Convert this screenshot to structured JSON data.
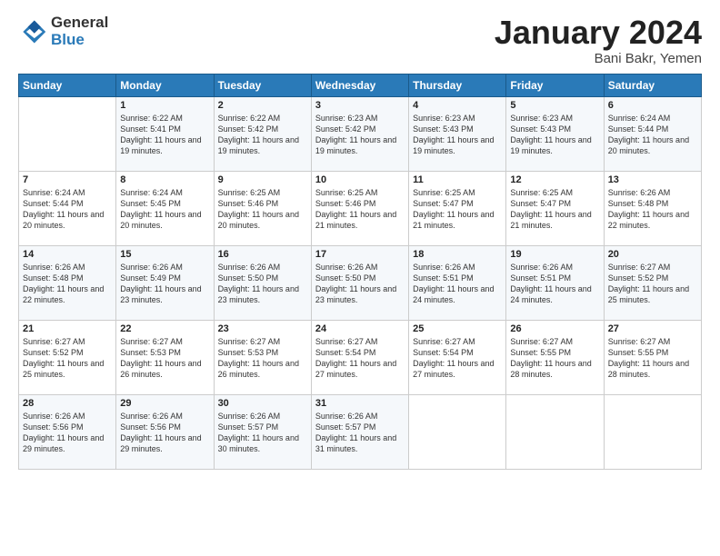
{
  "header": {
    "logo_general": "General",
    "logo_blue": "Blue",
    "month_title": "January 2024",
    "subtitle": "Bani Bakr, Yemen"
  },
  "days_of_week": [
    "Sunday",
    "Monday",
    "Tuesday",
    "Wednesday",
    "Thursday",
    "Friday",
    "Saturday"
  ],
  "weeks": [
    [
      {
        "day": "",
        "sunrise": "",
        "sunset": "",
        "daylight": ""
      },
      {
        "day": "1",
        "sunrise": "Sunrise: 6:22 AM",
        "sunset": "Sunset: 5:41 PM",
        "daylight": "Daylight: 11 hours and 19 minutes."
      },
      {
        "day": "2",
        "sunrise": "Sunrise: 6:22 AM",
        "sunset": "Sunset: 5:42 PM",
        "daylight": "Daylight: 11 hours and 19 minutes."
      },
      {
        "day": "3",
        "sunrise": "Sunrise: 6:23 AM",
        "sunset": "Sunset: 5:42 PM",
        "daylight": "Daylight: 11 hours and 19 minutes."
      },
      {
        "day": "4",
        "sunrise": "Sunrise: 6:23 AM",
        "sunset": "Sunset: 5:43 PM",
        "daylight": "Daylight: 11 hours and 19 minutes."
      },
      {
        "day": "5",
        "sunrise": "Sunrise: 6:23 AM",
        "sunset": "Sunset: 5:43 PM",
        "daylight": "Daylight: 11 hours and 19 minutes."
      },
      {
        "day": "6",
        "sunrise": "Sunrise: 6:24 AM",
        "sunset": "Sunset: 5:44 PM",
        "daylight": "Daylight: 11 hours and 20 minutes."
      }
    ],
    [
      {
        "day": "7",
        "sunrise": "Sunrise: 6:24 AM",
        "sunset": "Sunset: 5:44 PM",
        "daylight": "Daylight: 11 hours and 20 minutes."
      },
      {
        "day": "8",
        "sunrise": "Sunrise: 6:24 AM",
        "sunset": "Sunset: 5:45 PM",
        "daylight": "Daylight: 11 hours and 20 minutes."
      },
      {
        "day": "9",
        "sunrise": "Sunrise: 6:25 AM",
        "sunset": "Sunset: 5:46 PM",
        "daylight": "Daylight: 11 hours and 20 minutes."
      },
      {
        "day": "10",
        "sunrise": "Sunrise: 6:25 AM",
        "sunset": "Sunset: 5:46 PM",
        "daylight": "Daylight: 11 hours and 21 minutes."
      },
      {
        "day": "11",
        "sunrise": "Sunrise: 6:25 AM",
        "sunset": "Sunset: 5:47 PM",
        "daylight": "Daylight: 11 hours and 21 minutes."
      },
      {
        "day": "12",
        "sunrise": "Sunrise: 6:25 AM",
        "sunset": "Sunset: 5:47 PM",
        "daylight": "Daylight: 11 hours and 21 minutes."
      },
      {
        "day": "13",
        "sunrise": "Sunrise: 6:26 AM",
        "sunset": "Sunset: 5:48 PM",
        "daylight": "Daylight: 11 hours and 22 minutes."
      }
    ],
    [
      {
        "day": "14",
        "sunrise": "Sunrise: 6:26 AM",
        "sunset": "Sunset: 5:48 PM",
        "daylight": "Daylight: 11 hours and 22 minutes."
      },
      {
        "day": "15",
        "sunrise": "Sunrise: 6:26 AM",
        "sunset": "Sunset: 5:49 PM",
        "daylight": "Daylight: 11 hours and 23 minutes."
      },
      {
        "day": "16",
        "sunrise": "Sunrise: 6:26 AM",
        "sunset": "Sunset: 5:50 PM",
        "daylight": "Daylight: 11 hours and 23 minutes."
      },
      {
        "day": "17",
        "sunrise": "Sunrise: 6:26 AM",
        "sunset": "Sunset: 5:50 PM",
        "daylight": "Daylight: 11 hours and 23 minutes."
      },
      {
        "day": "18",
        "sunrise": "Sunrise: 6:26 AM",
        "sunset": "Sunset: 5:51 PM",
        "daylight": "Daylight: 11 hours and 24 minutes."
      },
      {
        "day": "19",
        "sunrise": "Sunrise: 6:26 AM",
        "sunset": "Sunset: 5:51 PM",
        "daylight": "Daylight: 11 hours and 24 minutes."
      },
      {
        "day": "20",
        "sunrise": "Sunrise: 6:27 AM",
        "sunset": "Sunset: 5:52 PM",
        "daylight": "Daylight: 11 hours and 25 minutes."
      }
    ],
    [
      {
        "day": "21",
        "sunrise": "Sunrise: 6:27 AM",
        "sunset": "Sunset: 5:52 PM",
        "daylight": "Daylight: 11 hours and 25 minutes."
      },
      {
        "day": "22",
        "sunrise": "Sunrise: 6:27 AM",
        "sunset": "Sunset: 5:53 PM",
        "daylight": "Daylight: 11 hours and 26 minutes."
      },
      {
        "day": "23",
        "sunrise": "Sunrise: 6:27 AM",
        "sunset": "Sunset: 5:53 PM",
        "daylight": "Daylight: 11 hours and 26 minutes."
      },
      {
        "day": "24",
        "sunrise": "Sunrise: 6:27 AM",
        "sunset": "Sunset: 5:54 PM",
        "daylight": "Daylight: 11 hours and 27 minutes."
      },
      {
        "day": "25",
        "sunrise": "Sunrise: 6:27 AM",
        "sunset": "Sunset: 5:54 PM",
        "daylight": "Daylight: 11 hours and 27 minutes."
      },
      {
        "day": "26",
        "sunrise": "Sunrise: 6:27 AM",
        "sunset": "Sunset: 5:55 PM",
        "daylight": "Daylight: 11 hours and 28 minutes."
      },
      {
        "day": "27",
        "sunrise": "Sunrise: 6:27 AM",
        "sunset": "Sunset: 5:55 PM",
        "daylight": "Daylight: 11 hours and 28 minutes."
      }
    ],
    [
      {
        "day": "28",
        "sunrise": "Sunrise: 6:26 AM",
        "sunset": "Sunset: 5:56 PM",
        "daylight": "Daylight: 11 hours and 29 minutes."
      },
      {
        "day": "29",
        "sunrise": "Sunrise: 6:26 AM",
        "sunset": "Sunset: 5:56 PM",
        "daylight": "Daylight: 11 hours and 29 minutes."
      },
      {
        "day": "30",
        "sunrise": "Sunrise: 6:26 AM",
        "sunset": "Sunset: 5:57 PM",
        "daylight": "Daylight: 11 hours and 30 minutes."
      },
      {
        "day": "31",
        "sunrise": "Sunrise: 6:26 AM",
        "sunset": "Sunset: 5:57 PM",
        "daylight": "Daylight: 11 hours and 31 minutes."
      },
      {
        "day": "",
        "sunrise": "",
        "sunset": "",
        "daylight": ""
      },
      {
        "day": "",
        "sunrise": "",
        "sunset": "",
        "daylight": ""
      },
      {
        "day": "",
        "sunrise": "",
        "sunset": "",
        "daylight": ""
      }
    ]
  ]
}
